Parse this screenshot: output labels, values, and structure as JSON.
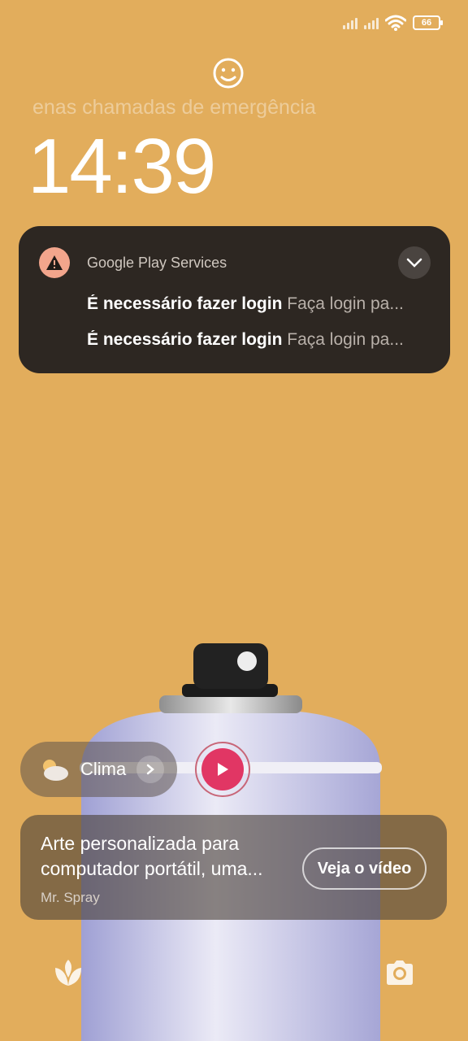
{
  "status_bar": {
    "battery": "66"
  },
  "lockscreen": {
    "emergency_text": "enas chamadas de emergência",
    "time": "14:39"
  },
  "notification": {
    "app": "Google Play Services",
    "items": [
      {
        "title": "É necessário fazer login",
        "body": "Faça login pa..."
      },
      {
        "title": "É necessário fazer login",
        "body": "Faça login pa..."
      }
    ]
  },
  "weather": {
    "label": "Clima"
  },
  "wallpaper_card": {
    "title_line1": "Arte personalizada para",
    "title_line2": "computador portátil, uma...",
    "author": "Mr. Spray",
    "button": "Veja o vídeo"
  },
  "colors": {
    "background": "#e2ad5c",
    "notification_bg": "#2d2722",
    "play_accent": "#e13664",
    "alert_icon": "#f2a58c"
  },
  "icons": [
    "signal-icon",
    "wifi-icon",
    "battery-icon",
    "face-unlock-icon",
    "warning-icon",
    "chevron-down-icon",
    "cloud-sun-icon",
    "chevron-right-icon",
    "play-icon",
    "flower-icon",
    "camera-icon"
  ]
}
